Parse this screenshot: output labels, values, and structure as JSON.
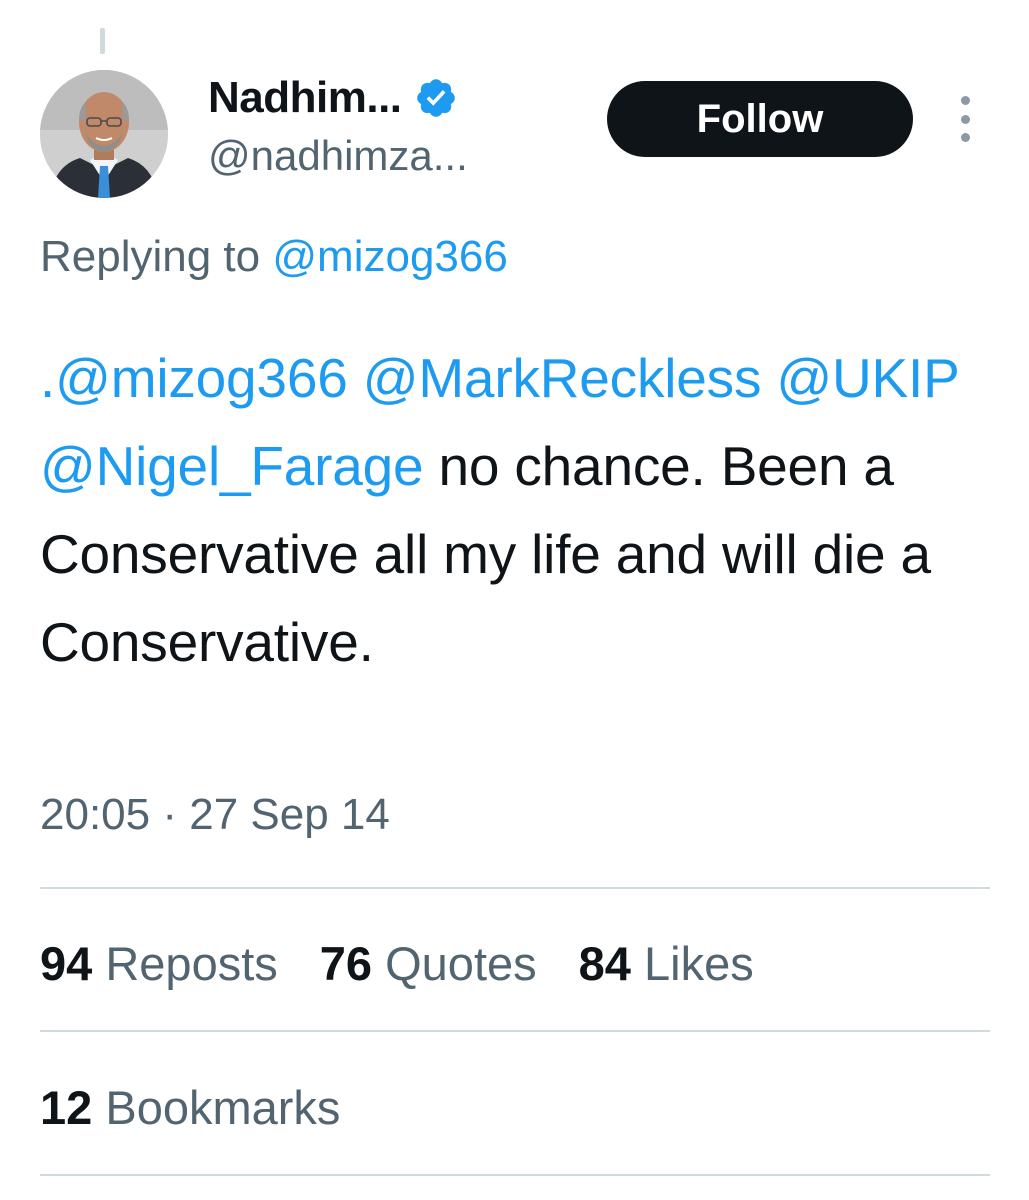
{
  "author": {
    "display_name": "Nadhim...",
    "handle": "@nadhimza...",
    "verified": true,
    "verified_color": "#1d9bf0",
    "avatar_icon": "profile-photo"
  },
  "follow_label": "Follow",
  "more_icon": "more-vertical-icon",
  "reply": {
    "prefix": "Replying to",
    "to": "@mizog366"
  },
  "tweet": {
    "mentions": [
      ".@mizog366",
      "@MarkReckless",
      "@UKIP",
      "@Nigel_Farage"
    ],
    "text": "no chance. Been a Conservative all my life and will die a Conservative."
  },
  "timestamp": {
    "time": "20:05",
    "separator": "·",
    "date": "27 Sep 14"
  },
  "stats": {
    "reposts": {
      "count": "94",
      "label": "Reposts"
    },
    "quotes": {
      "count": "76",
      "label": "Quotes"
    },
    "likes": {
      "count": "84",
      "label": "Likes"
    },
    "bookmarks": {
      "count": "12",
      "label": "Bookmarks"
    }
  },
  "colors": {
    "link": "#1d9bf0",
    "text": "#0f1419",
    "secondary": "#536471",
    "button_bg": "#0f1419",
    "divider": "#cfd9de"
  }
}
